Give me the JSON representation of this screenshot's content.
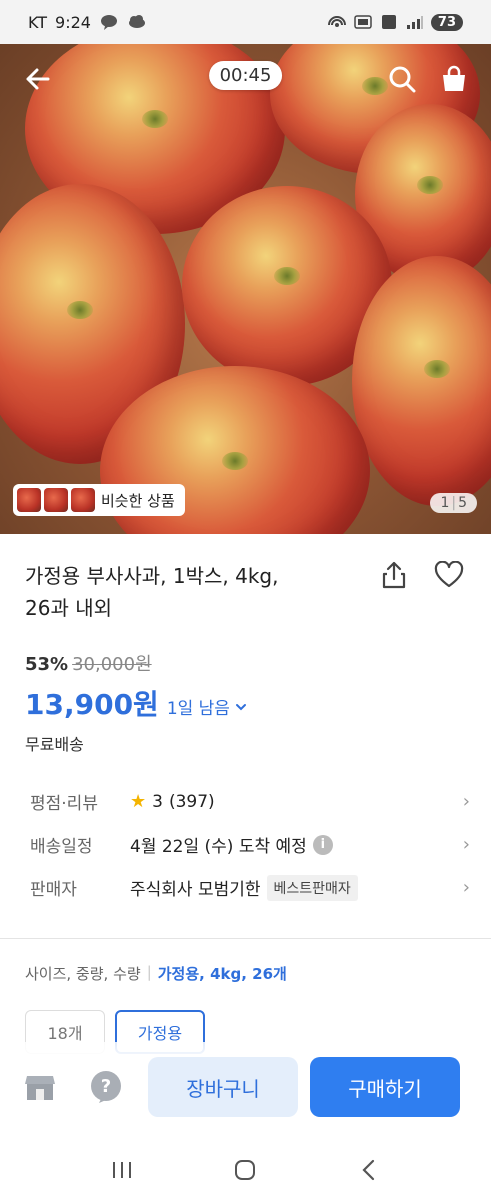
{
  "status_bar": {
    "carrier": "KT",
    "time": "9:24",
    "battery": "73"
  },
  "hero": {
    "timer": "00:45",
    "similar_label": "비슷한 상품",
    "page_current": "1",
    "page_total": "5"
  },
  "product": {
    "title_line1": "가정용 부사사과, 1박스, 4kg,",
    "title_line2": "26과 내외",
    "discount_pct": "53%",
    "original_price": "30,000원",
    "price": "13,900원",
    "deadline": "1일 남음",
    "shipping": "무료배송"
  },
  "info": {
    "rating_label": "평점·리뷰",
    "rating_value": "3",
    "review_count": "(397)",
    "delivery_label": "배송일정",
    "delivery_value": "4월 22일 (수) 도착 예정",
    "seller_label": "판매자",
    "seller_value": "주식회사 모범기한",
    "seller_badge": "베스트판매자"
  },
  "options": {
    "summary_label": "사이즈, 중량, 수량",
    "selected": "가정용, 4kg, 26개",
    "chips": [
      "18개",
      "가정용"
    ]
  },
  "actions": {
    "cart": "장바구니",
    "buy": "구매하기"
  },
  "colors": {
    "accent": "#2f6fdb",
    "buy_bg": "#2f7ef0",
    "cart_bg": "#e4eefb"
  }
}
